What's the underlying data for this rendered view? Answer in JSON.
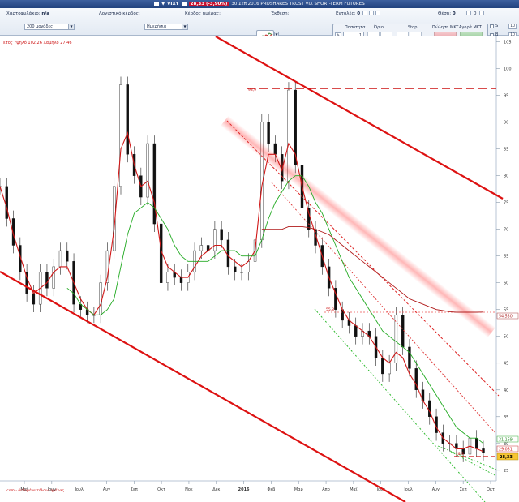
{
  "title_bar": {
    "symbol": "VIXY",
    "change": "28,33 (-3,90%)",
    "description": "30 Σεπ 2016 PROSHARES TRUST VIX SHORT-TERM FUTURES"
  },
  "toolbar": {
    "portfolio_label": "Χαρτοφυλάκιο:",
    "portfolio_value": "n/a",
    "accounting_profit_label": "Λογιστικό κέρδος:",
    "daily_profit_label": "Κέρδος ημέρας:",
    "exposure_label": "Έκθεση:",
    "orders_label": "Εντολές:",
    "orders_value": "0",
    "position_label": "Θέση:",
    "position_value": "0",
    "position_extra": "0",
    "units_select": "200 μονάδες",
    "period_select": "Ημερήσια"
  },
  "order_panel": {
    "quantity_label": "Ποσότητα",
    "quantity_value": "1",
    "limit_label": "Όριο",
    "stop_label": "Stop",
    "sell_label": "Πώληση MKT",
    "buy_label": "Αγορά MKT",
    "side_s": "S",
    "side_b": "B",
    "side_s_value": "10",
    "side_b_value": "10"
  },
  "chart_info": {
    "info_label": "ετος Υψηλό 102,26 Χαμηλό 27,46",
    "marker_high": "98,9",
    "marker_mid": "55,8",
    "marker_low": "28,3",
    "price_tag_top": "31,169",
    "price_tag_mid": "29,081",
    "price_tag_last": "28,33",
    "ma_tag": "54,530",
    "footer_note": "...com - δεδομένα τέλους ημέρας"
  },
  "chart_data": {
    "type": "line",
    "y_axis_ticks": [
      "105",
      "100",
      "95",
      "90",
      "85",
      "80",
      "75",
      "70",
      "65",
      "60",
      "55",
      "50",
      "45",
      "40",
      "35",
      "30",
      "25"
    ],
    "x_axis_labels": [
      "Μαϊ",
      "Ιουν",
      "Ιουλ",
      "Αυγ",
      "Σεπ",
      "Οκτ",
      "Νοε",
      "Δεκ",
      "2016",
      "Φεβ",
      "Μαρ",
      "Απρ",
      "Μαϊ",
      "Ιουν",
      "Ιουλ",
      "Αυγ",
      "Σεπ",
      "Οκτ"
    ],
    "ylim": [
      23,
      106
    ],
    "series": [
      {
        "color": "#000000",
        "values": [
          78,
          72,
          67,
          62,
          58,
          56,
          62,
          59,
          63,
          66,
          64,
          56,
          55,
          54,
          54,
          60,
          66,
          78,
          97,
          84,
          80,
          76,
          86,
          71,
          60,
          62,
          61,
          60,
          62,
          66,
          67,
          66,
          70,
          68,
          63,
          62,
          62,
          64,
          68,
          90,
          86,
          84,
          79,
          96,
          82,
          74,
          70,
          67,
          63,
          59,
          55,
          53,
          52,
          50,
          51,
          50,
          46,
          43,
          45,
          54,
          48,
          44,
          40,
          38,
          35,
          32,
          30,
          30,
          29,
          28,
          31,
          29,
          28.3
        ]
      },
      {
        "color": "#d01818",
        "values": [
          78,
          74,
          69,
          65,
          61,
          58,
          59,
          60,
          62,
          63,
          63,
          60,
          57,
          55,
          54,
          56,
          61,
          70,
          85,
          88,
          82,
          78,
          79,
          75,
          66,
          63,
          62,
          61,
          61,
          63,
          65,
          66,
          67,
          67,
          65,
          64,
          63,
          64,
          66,
          78,
          84,
          84,
          81,
          86,
          84,
          78,
          73,
          69,
          65,
          61,
          58,
          55,
          53,
          52,
          51,
          50,
          48,
          46,
          45,
          47,
          46,
          43,
          41,
          38,
          36,
          33,
          31,
          30,
          29,
          29,
          29.5,
          29,
          28.5
        ]
      },
      {
        "color": "#22aa22",
        "values": [
          null,
          null,
          null,
          null,
          null,
          null,
          null,
          null,
          null,
          null,
          59,
          58,
          56,
          55,
          54,
          54,
          55,
          57,
          63,
          69,
          73,
          74,
          75,
          74,
          72,
          70,
          67,
          65,
          64,
          64,
          64,
          64,
          65,
          66,
          66,
          66,
          65,
          65,
          65,
          68,
          72,
          75,
          77,
          79,
          80,
          80,
          78,
          75,
          73,
          70,
          67,
          64,
          61,
          59,
          57,
          55,
          53,
          51,
          50,
          49,
          48,
          47,
          45,
          43,
          41,
          39,
          37,
          35,
          33,
          32,
          31,
          31,
          30
        ]
      },
      {
        "color": "#b01a1a",
        "values": [
          null,
          null,
          null,
          null,
          null,
          null,
          null,
          null,
          null,
          null,
          null,
          null,
          null,
          null,
          null,
          null,
          null,
          null,
          null,
          null,
          null,
          null,
          null,
          null,
          null,
          null,
          null,
          null,
          null,
          null,
          null,
          null,
          null,
          null,
          null,
          null,
          null,
          null,
          null,
          70,
          70,
          70,
          70,
          70.5,
          70.5,
          70.5,
          70.3,
          70,
          69.5,
          69,
          68,
          67,
          66,
          65,
          64,
          63,
          62,
          61,
          60,
          59,
          58,
          57,
          56.5,
          56,
          55.5,
          55,
          54.8,
          54.6,
          54.5,
          54.5,
          54.5,
          54.5,
          54.53
        ]
      }
    ]
  },
  "colors": {
    "titlebar": "#21427e",
    "change_badge": "#c8102e",
    "trend_red": "#dd1111",
    "ma_green": "#22aa22",
    "guide_green": "#33bb33"
  }
}
